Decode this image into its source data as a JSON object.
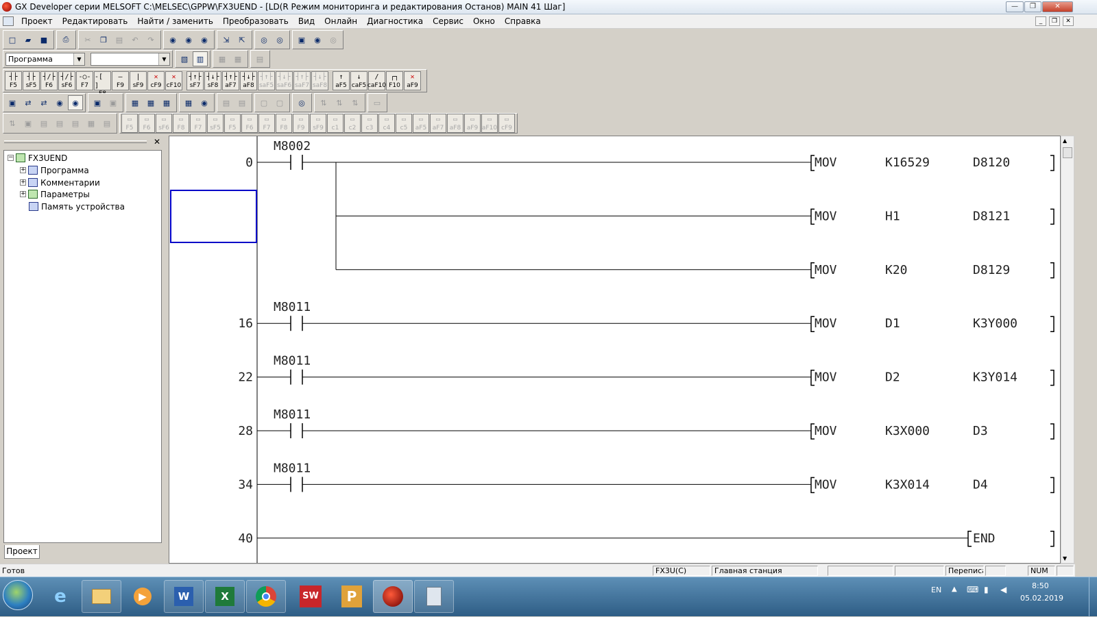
{
  "window": {
    "title": "GX Developer серии MELSOFT C:\\MELSEC\\GPPW\\FX3UEND - [LD(R Режим мониторинга и редактирования Останов)     MAIN    41 Шаг]"
  },
  "menu": [
    "Проект",
    "Редактировать",
    "Найти / заменить",
    "Преобразовать",
    "Вид",
    "Онлайн",
    "Диагностика",
    "Сервис",
    "Окно",
    "Справка"
  ],
  "toolbar": {
    "program_combo": "Программа",
    "second_combo": "",
    "ladder_keys": [
      {
        "sym": "┤├",
        "key": "F5"
      },
      {
        "sym": "┤├",
        "key": "sF5"
      },
      {
        "sym": "┤/├",
        "key": "F6"
      },
      {
        "sym": "┤/├",
        "key": "sF6"
      },
      {
        "sym": "-○-",
        "key": "F7"
      },
      {
        "sym": "-[ ]",
        "key": "F8"
      },
      {
        "sym": "—",
        "key": "F9"
      },
      {
        "sym": "|",
        "key": "sF9"
      },
      {
        "sym": "✕",
        "key": "cF9"
      },
      {
        "sym": "✕",
        "key": "cF10"
      },
      {
        "sym": "┤↑├",
        "key": "sF7"
      },
      {
        "sym": "┤↓├",
        "key": "sF8"
      },
      {
        "sym": "┤↑├",
        "key": "aF7"
      },
      {
        "sym": "┤↓├",
        "key": "aF8"
      },
      {
        "sym": "┤↑├",
        "key": "saF5"
      },
      {
        "sym": "┤↓├",
        "key": "saF6"
      },
      {
        "sym": "┤↑├",
        "key": "saF7"
      },
      {
        "sym": "┤↓├",
        "key": "saF8"
      },
      {
        "sym": "↑",
        "key": "aF5"
      },
      {
        "sym": "↓",
        "key": "caF5"
      },
      {
        "sym": "/",
        "key": "caF10"
      },
      {
        "sym": "┌┐",
        "key": "F10"
      },
      {
        "sym": "✕",
        "key": "aF9"
      }
    ],
    "sfc_keys": [
      "F5",
      "F6",
      "sF6",
      "F8",
      "F7",
      "sF5",
      "F5",
      "F6",
      "F7",
      "F8",
      "F9",
      "sF9",
      "c1",
      "c2",
      "c3",
      "c4",
      "c5",
      "aF5",
      "aF7",
      "aF8",
      "aF9",
      "aF10",
      "cF9"
    ]
  },
  "project_tree": {
    "root": "FX3UEND",
    "items": [
      "Программа",
      "Комментарии",
      "Параметры",
      "Память устройства"
    ],
    "tab": "Проект"
  },
  "ladder": {
    "rungs": [
      {
        "step": "0",
        "contact": "M8002",
        "instructions": [
          {
            "op": "MOV",
            "src": "K16529",
            "dst": "D8120"
          },
          {
            "op": "MOV",
            "src": "H1",
            "dst": "D8121"
          },
          {
            "op": "MOV",
            "src": "K20",
            "dst": "D8129"
          }
        ]
      },
      {
        "step": "16",
        "contact": "M8011",
        "instructions": [
          {
            "op": "MOV",
            "src": "D1",
            "dst": "K3Y000"
          }
        ]
      },
      {
        "step": "22",
        "contact": "M8011",
        "instructions": [
          {
            "op": "MOV",
            "src": "D2",
            "dst": "K3Y014"
          }
        ]
      },
      {
        "step": "28",
        "contact": "M8011",
        "instructions": [
          {
            "op": "MOV",
            "src": "K3X000",
            "dst": "D3"
          }
        ]
      },
      {
        "step": "34",
        "contact": "M8011",
        "instructions": [
          {
            "op": "MOV",
            "src": "K3X014",
            "dst": "D4"
          }
        ]
      }
    ],
    "end": {
      "step": "40",
      "op": "END"
    }
  },
  "status": {
    "ready": "Готов",
    "plc": "FX3U(C)",
    "station": "Главная станция",
    "mode": "Переписа",
    "num": "NUM"
  },
  "taskbar": {
    "lang": "EN",
    "time": "8:50",
    "date": "05.02.2019",
    "apps": [
      "ie-icon",
      "explorer-icon",
      "media-player-icon",
      "word-icon",
      "excel-icon",
      "chrome-icon",
      "solidworks-icon",
      "powerpoint-icon",
      "gx-developer-icon",
      "calculator-icon"
    ],
    "app_labels": {
      "word": "W",
      "excel": "X",
      "solidworks": "SW",
      "powerpoint": "P"
    }
  }
}
